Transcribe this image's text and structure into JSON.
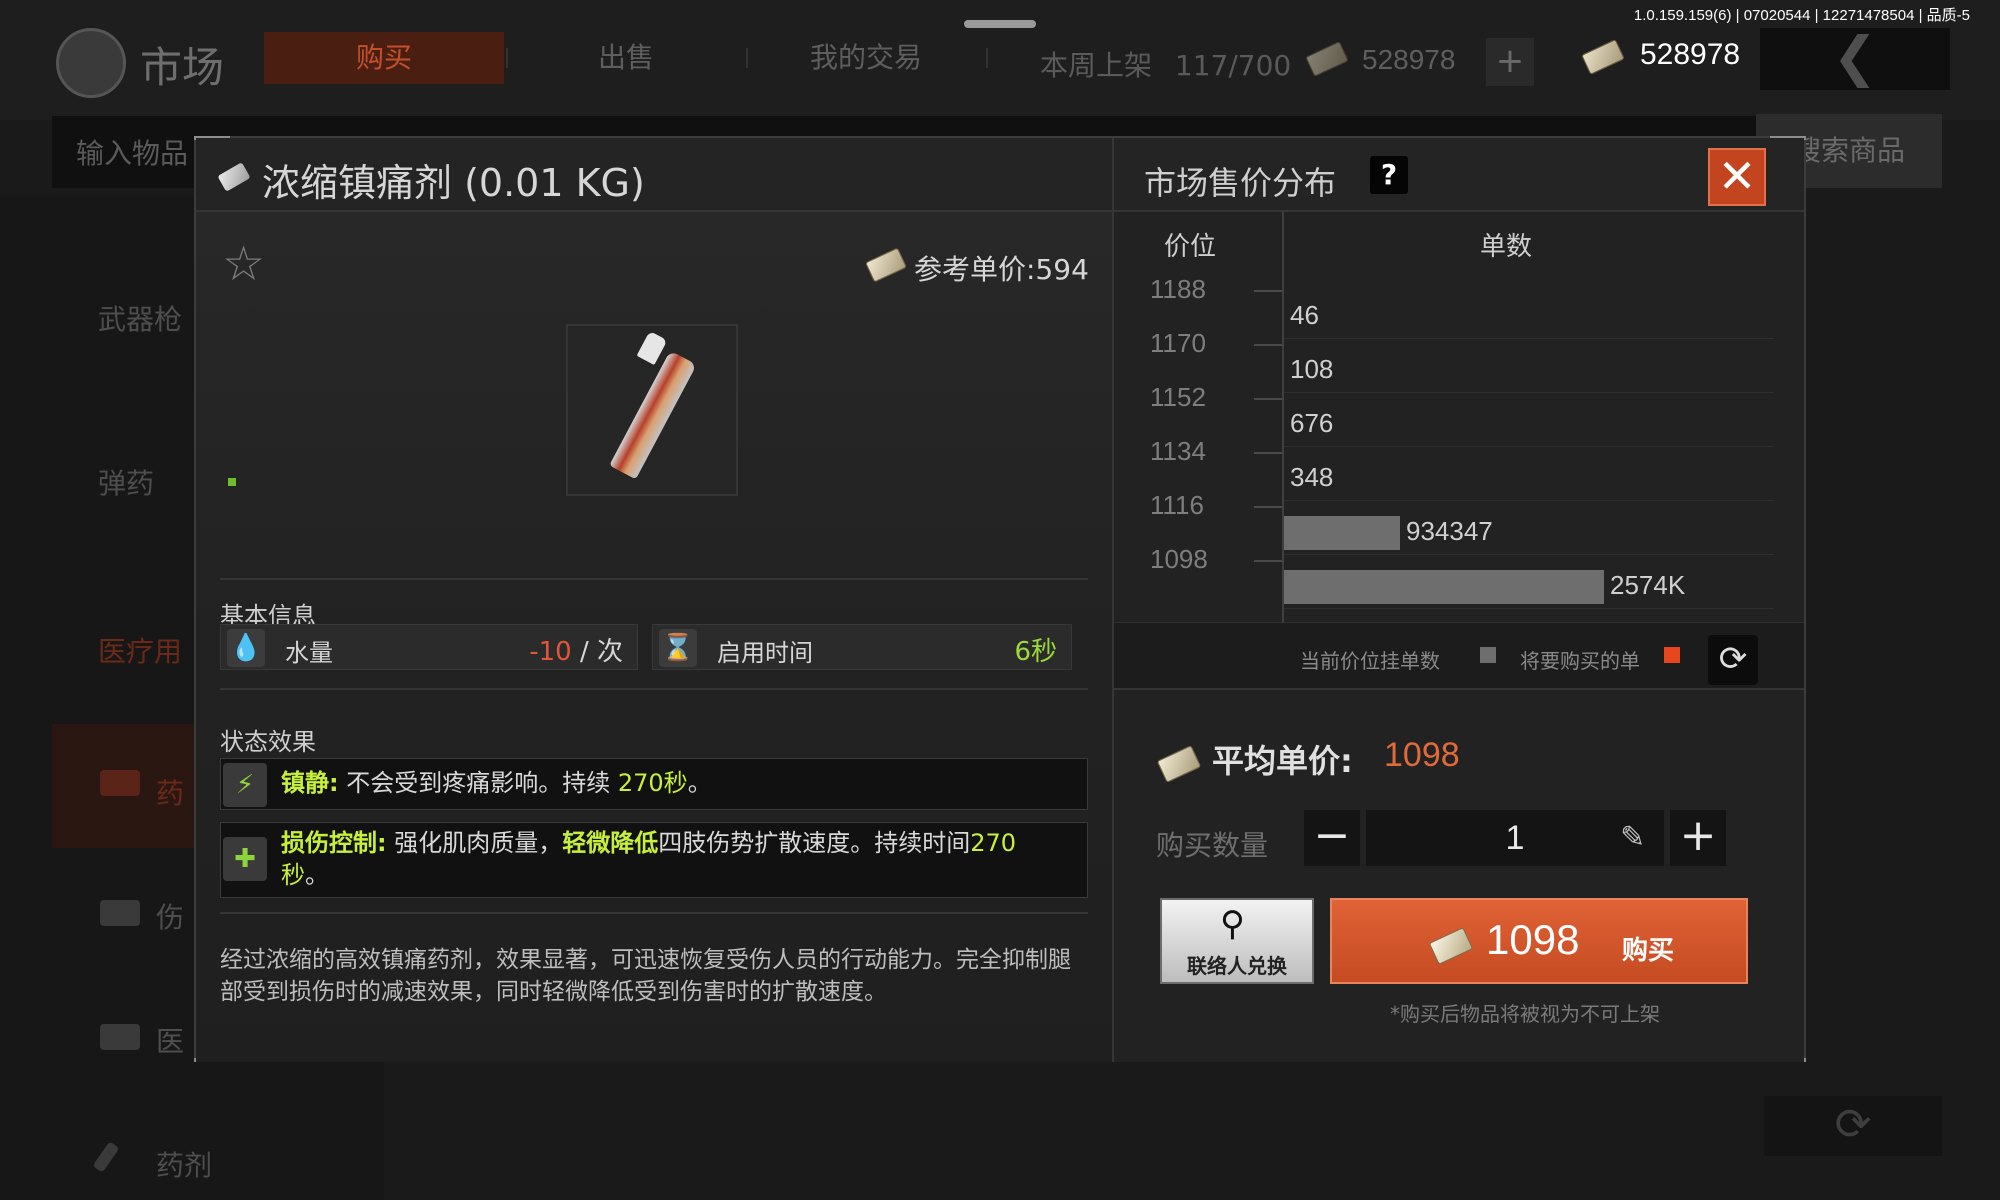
{
  "version_info": "1.0.159.159(6) | 07020544 | 12271478504 | 品质-5",
  "header": {
    "title": "市场",
    "tabs": [
      "购买",
      "出售",
      "我的交易"
    ],
    "active_tab": "购买",
    "weekly_label": "本周上架",
    "weekly_value": "117/700",
    "currency_1": "528978",
    "currency_2": "528978",
    "add_symbol": "+",
    "back_symbol": "❮"
  },
  "search": {
    "placeholder": "输入物品",
    "button_label": "搜索商品"
  },
  "sidebar": {
    "items": [
      "武器枪",
      "弹药",
      "医疗用",
      "药",
      "伤",
      "医",
      "药剂"
    ]
  },
  "modal": {
    "item_title": "浓缩镇痛剂 (0.01 KG)",
    "ref_price_label": "参考单价:594",
    "basic_info_label": "基本信息",
    "stats": [
      {
        "label": "水量",
        "value": "-10",
        "unit": " / 次",
        "icon": "water-drop-icon"
      },
      {
        "label": "启用时间",
        "value": "6秒",
        "icon": "hourglass-icon"
      }
    ],
    "effects_label": "状态效果",
    "effect_1": {
      "key": "镇静:",
      "text": " 不会受到疼痛影响。持续 ",
      "highlight": "270秒",
      "tail": "。"
    },
    "effect_2": {
      "key": "损伤控制:",
      "text_a": " 强化肌肉质量，",
      "highlight_a": "轻微降低",
      "text_b": "四肢伤势扩散速度。持续时间",
      "highlight_b": "270",
      "line2_highlight": "秒",
      "line2_tail": "。"
    },
    "description": "经过浓缩的高效镇痛药剂，效果显著，可迅速恢复受伤人员的行动能力。完全抑制腿部受到损伤时的减速效果，同时轻微降低受到伤害时的扩散速度。"
  },
  "distribution": {
    "title": "市场售价分布",
    "help_symbol": "?",
    "close_symbol": "✕",
    "col_price": "价位",
    "col_orders": "单数",
    "legend_current": "当前价位挂单数",
    "legend_buy": "将要购买的单",
    "colors": {
      "current": "#6e6e6e",
      "buy": "#e8471e"
    }
  },
  "chart_data": {
    "type": "bar",
    "orientation": "horizontal",
    "y_ticks": [
      1188,
      1170,
      1152,
      1134,
      1116,
      1098
    ],
    "rows": [
      {
        "label": "46",
        "value": 46
      },
      {
        "label": "108",
        "value": 108
      },
      {
        "label": "676",
        "value": 676
      },
      {
        "label": "348",
        "value": 348
      },
      {
        "label": "934347",
        "value": 934347
      },
      {
        "label": "2574K",
        "value": 2574000
      }
    ]
  },
  "purchase": {
    "avg_label": "平均单价:",
    "avg_value": "1098",
    "qty_label": "购买数量",
    "qty_value": "1",
    "minus_symbol": "−",
    "plus_symbol": "+",
    "exchange_label": "联络人兑换",
    "buy_price": "1098",
    "buy_label": "购买",
    "note": "*购买后物品将被视为不可上架"
  }
}
